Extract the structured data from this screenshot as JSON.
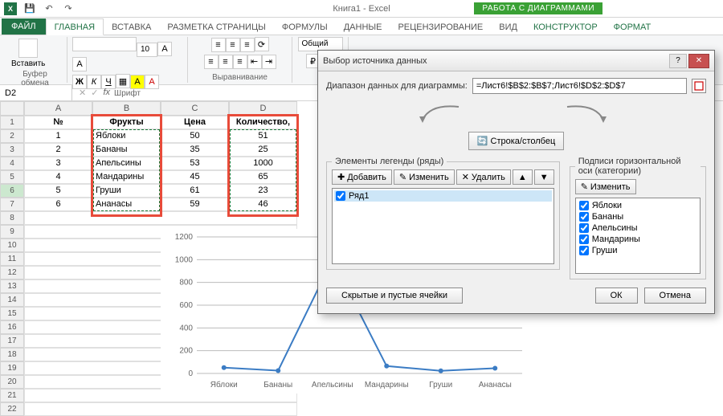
{
  "titlebar": {
    "title": "Книга1 - Excel",
    "chart_tools": "РАБОТА С ДИАГРАММАМИ"
  },
  "tabs": {
    "file": "ФАЙЛ",
    "items": [
      "ГЛАВНАЯ",
      "ВСТАВКА",
      "РАЗМЕТКА СТРАНИЦЫ",
      "ФОРМУЛЫ",
      "ДАННЫЕ",
      "РЕЦЕНЗИРОВАНИЕ",
      "ВИД",
      "КОНСТРУКТОР",
      "ФОРМАТ"
    ]
  },
  "ribbon": {
    "clipboard": {
      "label": "Буфер обмена",
      "paste": "Вставить"
    },
    "font": {
      "label": "Шрифт",
      "size": "10",
      "letters": "A"
    },
    "align": {
      "label": "Выравнивание"
    },
    "number": {
      "label": "Общий"
    },
    "paste_label": "Вставить"
  },
  "formula_bar": {
    "namebox": "D2",
    "fx": "fx"
  },
  "columns": [
    "A",
    "B",
    "C",
    "D"
  ],
  "table": {
    "headers": [
      "№",
      "Фрукты",
      "Цена",
      "Количество, кг"
    ],
    "rows": [
      [
        "1",
        "Яблоки",
        "50",
        "51"
      ],
      [
        "2",
        "Бананы",
        "35",
        "25"
      ],
      [
        "3",
        "Апельсины",
        "53",
        "1000"
      ],
      [
        "4",
        "Мандарины",
        "45",
        "65"
      ],
      [
        "5",
        "Груши",
        "61",
        "23"
      ],
      [
        "6",
        "Ананасы",
        "59",
        "46"
      ]
    ]
  },
  "dialog": {
    "title": "Выбор источника данных",
    "range_label": "Диапазон данных для диаграммы:",
    "range_value": "=Лист6!$B$2:$B$7;Лист6!$D$2:$D$7",
    "swap": "Строка/столбец",
    "legend_title": "Элементы легенды (ряды)",
    "axis_title": "Подписи горизонтальной оси (категории)",
    "add": "Добавить",
    "edit": "Изменить",
    "delete": "Удалить",
    "series": [
      "Ряд1"
    ],
    "categories": [
      "Яблоки",
      "Бананы",
      "Апельсины",
      "Мандарины",
      "Груши"
    ],
    "hidden": "Скрытые и пустые ячейки",
    "ok": "ОК",
    "cancel": "Отмена"
  },
  "chart_data": {
    "type": "line",
    "categories": [
      "Яблоки",
      "Бананы",
      "Апельсины",
      "Мандарины",
      "Груши",
      "Ананасы"
    ],
    "values": [
      51,
      25,
      1000,
      65,
      23,
      46
    ],
    "ylim": [
      0,
      1200
    ],
    "yticks": [
      0,
      200,
      400,
      600,
      800,
      1000,
      1200
    ],
    "title": "",
    "xlabel": "",
    "ylabel": ""
  }
}
